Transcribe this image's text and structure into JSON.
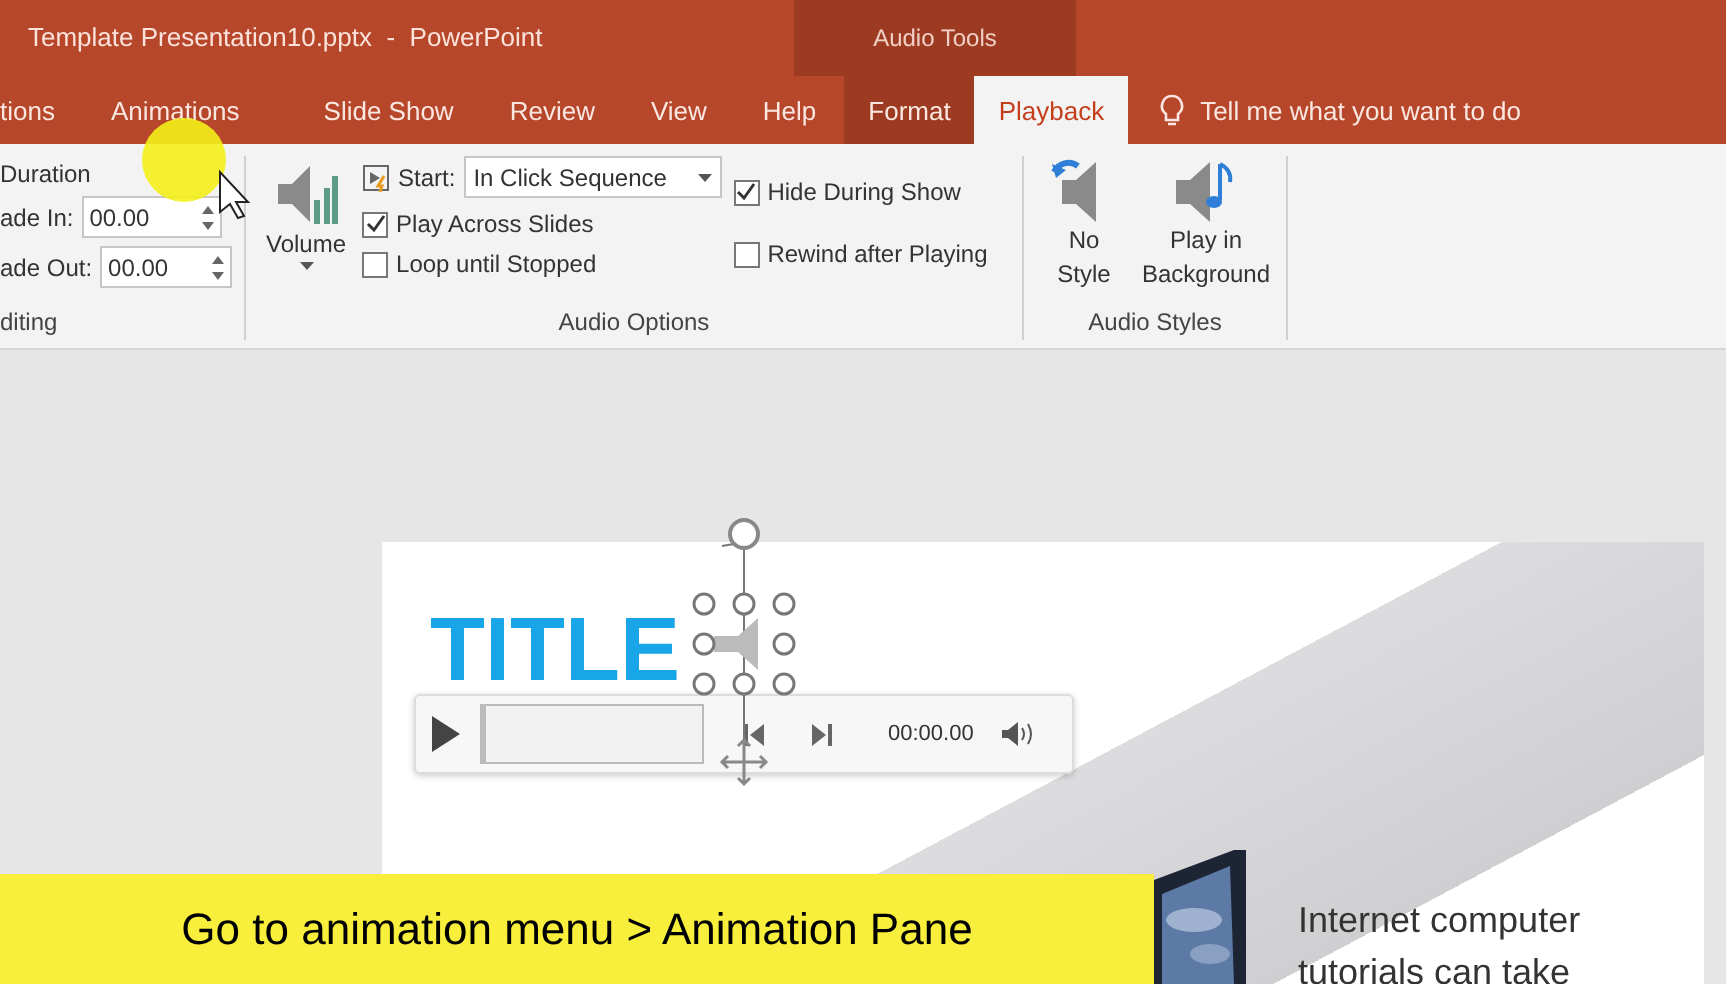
{
  "window": {
    "title": "Template Presentation10.pptx  -  PowerPoint",
    "context_title": "Audio Tools"
  },
  "tabs": [
    {
      "label": "tions",
      "selected": false,
      "contextual": false
    },
    {
      "label": "Animations",
      "selected": false,
      "contextual": false
    },
    {
      "label": "Slide Show",
      "selected": false,
      "contextual": false
    },
    {
      "label": "Review",
      "selected": false,
      "contextual": false
    },
    {
      "label": "View",
      "selected": false,
      "contextual": false
    },
    {
      "label": "Help",
      "selected": false,
      "contextual": false
    },
    {
      "label": "Format",
      "selected": false,
      "contextual": true
    },
    {
      "label": "Playback",
      "selected": true,
      "contextual": true
    }
  ],
  "tell_me": "Tell me what you want to do",
  "ribbon": {
    "editing": {
      "duration_label": "Duration",
      "fade_in_label": "ade In:",
      "fade_in_value": "00.00",
      "fade_out_label": "ade Out:",
      "fade_out_value": "00.00",
      "group_label": "diting"
    },
    "audio_options": {
      "volume_label": "Volume",
      "start_label": "Start:",
      "start_value": "In Click Sequence",
      "checkboxes": [
        {
          "label": "Play Across Slides",
          "checked": true
        },
        {
          "label": "Loop until Stopped",
          "checked": false
        },
        {
          "label": "Hide During Show",
          "checked": true
        },
        {
          "label": "Rewind after Playing",
          "checked": false
        }
      ],
      "group_label": "Audio Options"
    },
    "audio_styles": {
      "buttons": [
        {
          "kind": "no-style",
          "label": "No Style"
        },
        {
          "kind": "background",
          "label": "Play in Background"
        }
      ],
      "group_label": "Audio Styles"
    }
  },
  "slide": {
    "title": "TITLE",
    "body": "Internet computer tutorials can take",
    "player": {
      "time": "00:00.00",
      "level": 0
    }
  },
  "caption": "Go to animation menu > Animation Pane"
}
